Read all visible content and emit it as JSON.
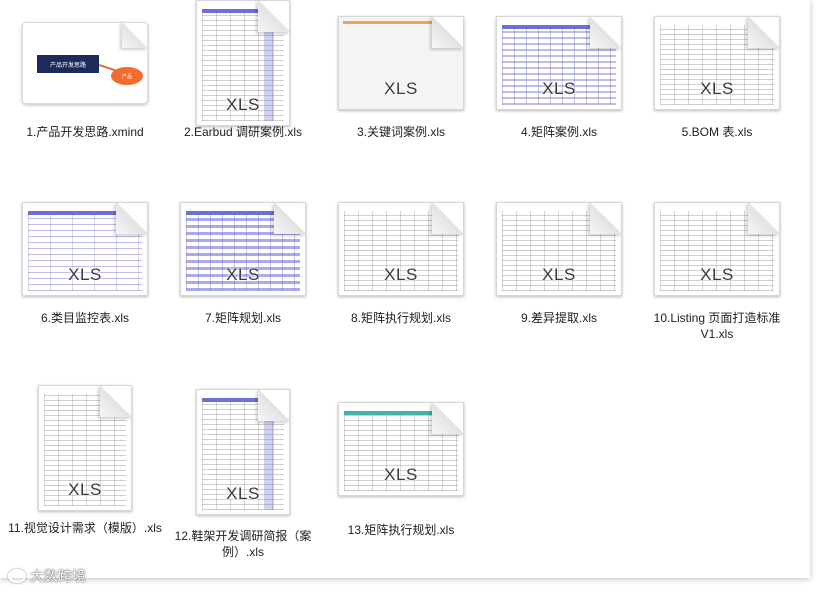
{
  "files": [
    {
      "name": "1.产品开发思路.xmind",
      "type": "xmind",
      "icon": "mindmap-file-icon",
      "mind": {
        "central": "产品开发思路",
        "branch": "产品"
      }
    },
    {
      "name": "2.Earbud 调研案例.xls",
      "type": "xls",
      "ext": "XLS",
      "icon": "spreadsheet-file-icon"
    },
    {
      "name": "3.关键词案例.xls",
      "type": "xls",
      "ext": "XLS",
      "icon": "spreadsheet-file-icon"
    },
    {
      "name": "4.矩阵案例.xls",
      "type": "xls",
      "ext": "XLS",
      "icon": "spreadsheet-file-icon"
    },
    {
      "name": "5.BOM 表.xls",
      "type": "xls",
      "ext": "XLS",
      "icon": "spreadsheet-file-icon"
    },
    {
      "name": "6.类目监控表.xls",
      "type": "xls",
      "ext": "XLS",
      "icon": "spreadsheet-file-icon"
    },
    {
      "name": "7.矩阵规划.xls",
      "type": "xls",
      "ext": "XLS",
      "icon": "spreadsheet-file-icon"
    },
    {
      "name": "8.矩阵执行规划.xls",
      "type": "xls",
      "ext": "XLS",
      "icon": "spreadsheet-file-icon"
    },
    {
      "name": "9.差异提取.xls",
      "type": "xls",
      "ext": "XLS",
      "icon": "spreadsheet-file-icon"
    },
    {
      "name": "10.Listing 页面打造标准 V1.xls",
      "type": "xls",
      "ext": "XLS",
      "icon": "spreadsheet-file-icon"
    },
    {
      "name": "11.视觉设计需求（模版）.xls",
      "type": "xls",
      "ext": "XLS",
      "icon": "spreadsheet-file-icon"
    },
    {
      "name": "12.鞋架开发调研简报（案例）.xls",
      "type": "xls",
      "ext": "XLS",
      "icon": "spreadsheet-file-icon"
    },
    {
      "name": "13.矩阵执行规划.xls",
      "type": "xls",
      "ext": "XLS",
      "icon": "spreadsheet-file-icon"
    }
  ],
  "watermark": "大数跨境",
  "colors": {
    "mind_node": "#1c2a5c",
    "mind_branch": "#f26c2e",
    "sheet_accent": "#6d6fd8"
  }
}
